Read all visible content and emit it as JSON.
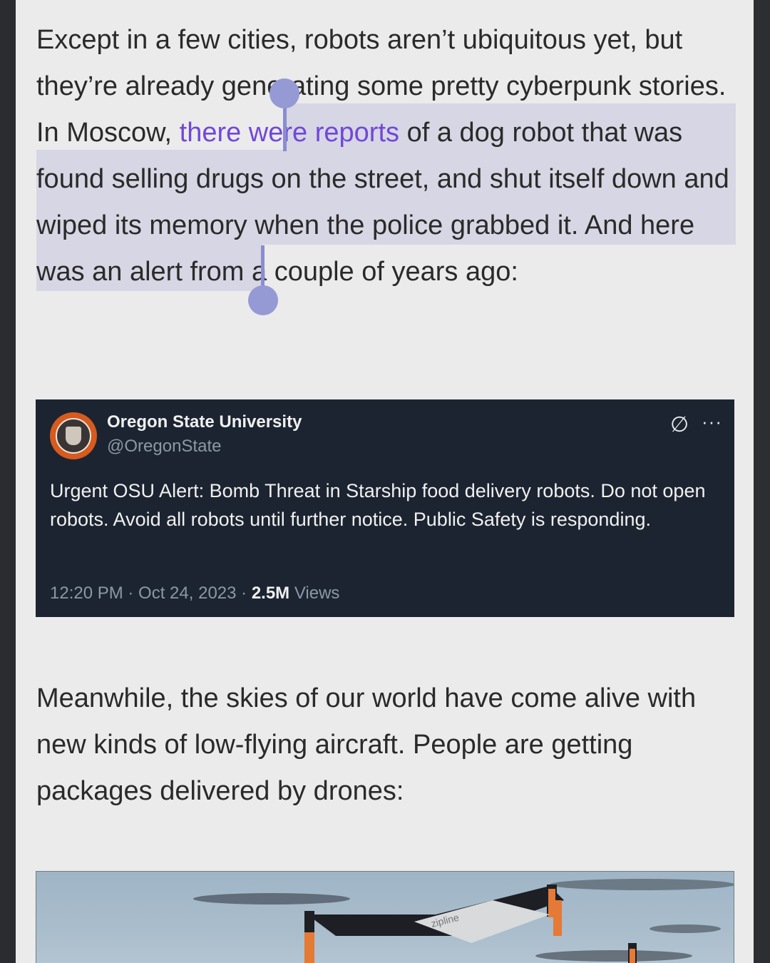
{
  "article": {
    "p1": {
      "before_link": "Except in a few cities, robots aren’t ubiquitous yet, but they’re already generating some pretty cyberpunk stories. In Moscow, ",
      "link": "there were reports",
      "after_link": " of a dog robot that was found selling drugs on the street, and shut itself down and wiped its memory when the police grabbed it. And here was an alert from a couple of years ago:"
    },
    "p2": "Meanwhile, the skies of our world have come alive with new kinds of low-flying aircraft. People are getting packages delivered by drones:"
  },
  "tweet": {
    "name": "Oregon State University",
    "handle": "@OregonState",
    "text": "Urgent OSU Alert: Bomb Threat in Starship food delivery robots. Do not open robots. Avoid all robots until further notice. Public Safety is responding.",
    "time": "12:20 PM · Oct 24, 2023 · ",
    "views_count": "2.5M",
    "views_label": " Views",
    "grok_icon": "∅",
    "more_icon": "···"
  },
  "colors": {
    "link": "#7147d8",
    "selection": "#d6d6e4",
    "handle": "#8a8dd0",
    "tweet_bg": "#1c2431"
  },
  "image": {
    "drone_label": "zipline"
  }
}
